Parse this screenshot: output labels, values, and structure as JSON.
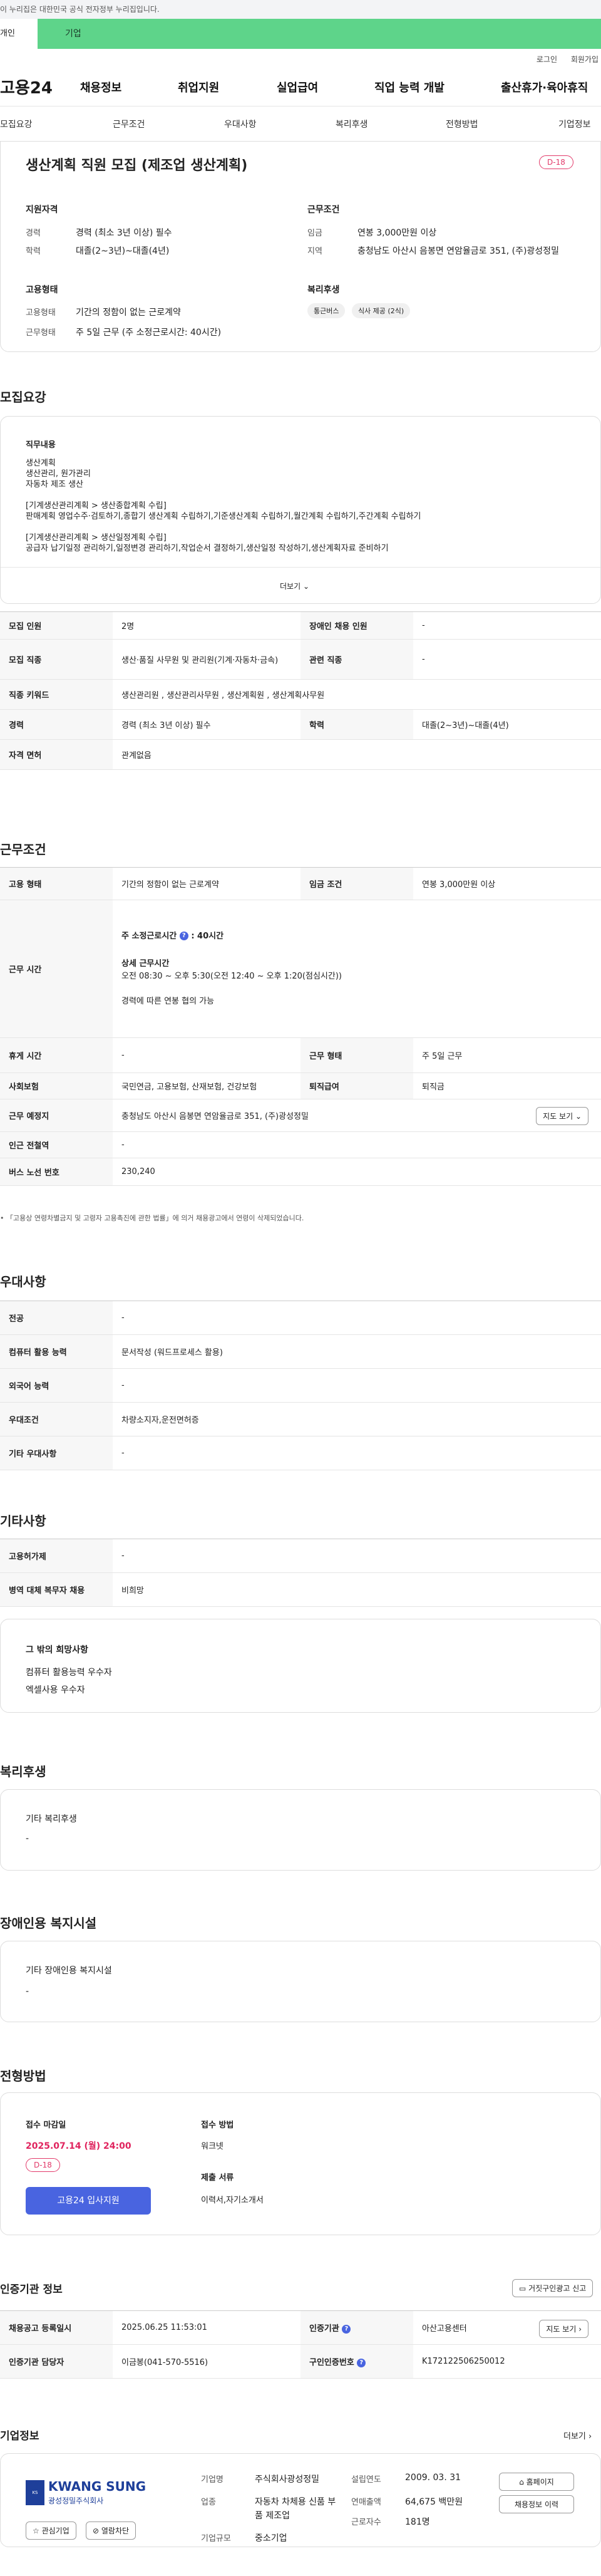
{
  "gov_banner": "이 누리집은 대한민국 공식 전자정부 누리집입니다.",
  "tabs": {
    "left": "개인",
    "right": "기업"
  },
  "util": {
    "login": "로그인",
    "join": "회원가입"
  },
  "gnb": {
    "logo": "고용24",
    "items": [
      "채용정보",
      "취업지원",
      "실업급여",
      "직업 능력 개발",
      "출산휴가·육아휴직"
    ]
  },
  "snb": [
    "모집요강",
    "근무조건",
    "우대사항",
    "복리후생",
    "전형방법",
    "기업정보"
  ],
  "summary": {
    "title": "생산계획 직원 모집 (제조업 생산계획)",
    "dday": "D-18",
    "qual_head": "지원자격",
    "career_label": "경력",
    "career": "경력 (최소 3년 이상) 필수",
    "edu_label": "학력",
    "edu": "대졸(2~3년)~대졸(4년)",
    "work_head": "근무조건",
    "wage_label": "임금",
    "wage": "연봉 3,000만원 이상",
    "region_label": "지역",
    "region": "충청남도 아산시 음봉면 연암율금로 351, (주)광성정밀",
    "emp_head": "고용형태",
    "type_label": "고용형태",
    "type": "기간의 정함이 없는 근로계약",
    "form_label": "근무형태",
    "form": "주 5일 근무 (주 소정근로시간: 40시간)",
    "welfare_head": "복리후생",
    "chips": [
      "통근버스",
      "식사 제공 (2식)"
    ]
  },
  "recruit": {
    "title": "모집요강",
    "job_head": "직무내용",
    "lines": [
      "생산계획",
      "생산관리, 원가관리",
      "자동차 제조 생산",
      "",
      "[기계생산관리계획 > 생산종합계획 수립]",
      "판매계획 영업수주·검토하기,종합기 생산계획 수립하기,기준생산계획 수립하기,월간계획 수립하기,주간계획 수립하기",
      "",
      "[기계생산관리계획 > 생산일정계획 수립]",
      "공급자 납기일정 관리하기,일정변경 관리하기,작업순서 결정하기,생산일정 작성하기,생산계획자료 준비하기"
    ],
    "more": "더보기",
    "rows": [
      {
        "l1": "모집 인원",
        "v1": "2명",
        "l2": "장애인 채용 인원",
        "v2": "-"
      },
      {
        "l1": "모집 직종",
        "v1": "생산·품질 사무원 및 관리원(기계·자동차·금속)",
        "l2": "관련 직종",
        "v2": "-"
      },
      {
        "l1": "직종 키워드",
        "v1": "생산관리원 , 생산관리사무원 , 생산계획원 , 생산계획사무원"
      },
      {
        "l1": "경력",
        "v1": "경력 (최소 3년 이상) 필수",
        "l2": "학력",
        "v2": "대졸(2~3년)~대졸(4년)"
      },
      {
        "l1": "자격 면허",
        "v1": "관계없음"
      }
    ]
  },
  "work": {
    "title": "근무조건",
    "type_l": "고용 형태",
    "type_v": "기간의 정함이 없는 근로계약",
    "wage_l": "임금 조건",
    "wage_v": "연봉 3,000만원 이상",
    "time_l": "근무 시간",
    "time_head": "주 소정근로시간",
    "time_hours": ": 40시간",
    "time_detail_head": "상세 근무시간",
    "time_detail": "오전 08:30 ~ 오후 5:30(오전 12:40 ~ 오후 1:20(점심시간))",
    "time_note": "경력에 따른 연봉 협의 가능",
    "rest_l": "휴게 시간",
    "rest_v": "-",
    "form_l": "근무 형태",
    "form_v": "주 5일 근무",
    "ins_l": "사회보험",
    "ins_v": "국민연금, 고용보험, 산재보험, 건강보험",
    "ret_l": "퇴직급여",
    "ret_v": "퇴직금",
    "place_l": "근무 예정지",
    "place_v": "충청남도 아산시 음봉면 연암율금로 351, (주)광성정밀",
    "map_btn": "지도 보기",
    "sub_l": "인근 전철역",
    "sub_v": "-",
    "bus_l": "버스 노선 번호",
    "bus_v": "230,240",
    "note": "「고용상 연령차별금지 및 고령자 고용촉진에 관한 법률」에 의거 채용광고에서 연령이 삭제되었습니다."
  },
  "pref": {
    "title": "우대사항",
    "rows": [
      {
        "l": "전공",
        "v": "-"
      },
      {
        "l": "컴퓨터 활용 능력",
        "v": "문서작성 (워드프로세스 활용)"
      },
      {
        "l": "외국어 능력",
        "v": "-"
      },
      {
        "l": "우대조건",
        "v": "차량소지자,운전면허증"
      },
      {
        "l": "기타 우대사항",
        "v": "-"
      }
    ]
  },
  "etc": {
    "title": "기타사항",
    "rows": [
      {
        "l": "고용허가제",
        "v": "-"
      },
      {
        "l": "병역 대체 복무자 채용",
        "v": "비희망"
      }
    ],
    "box_head": "그 밖의 희망사항",
    "box_lines": [
      "컴퓨터 활용능력 우수자",
      "엑셀사용 우수자"
    ]
  },
  "welfare": {
    "title": "복리후생",
    "head": "기타 복리후생",
    "value": "-"
  },
  "disabled": {
    "title": "장애인용 복지시설",
    "head": "기타 장애인용 복지시설",
    "value": "-"
  },
  "selection": {
    "title": "전형방법",
    "deadline_l": "접수 마감일",
    "deadline": "2025.07.14 (월) 24:00",
    "dday": "D-18",
    "apply_btn": "고용24 입사지원",
    "method_l": "접수 방법",
    "method_v": "워크넷",
    "docs_l": "제출 서류",
    "docs_v": "이력서,자기소개서"
  },
  "cert": {
    "title": "인증기관 정보",
    "report_btn": "거짓구인광고 신고",
    "reg_l": "채용공고 등록일시",
    "reg_v": "2025.06.25 11:53:01",
    "org_l": "인증기관",
    "org_v": "아산고용센터",
    "map_btn": "지도 보기",
    "mgr_l": "인증기관 담당자",
    "mgr_v": "이금봉(041-570-5516)",
    "no_l": "구인인증번호",
    "no_v": "K172122506250012"
  },
  "company": {
    "title": "기업정보",
    "more": "더보기",
    "logo_en": "KWANG SUNG",
    "logo_ko": "광성정밀주식회사",
    "fav_btn": "관심기업",
    "block_btn": "열람차단",
    "name_l": "기업명",
    "name_v": "주식회사광성정밀",
    "ind_l": "업종",
    "ind_v": "자동차 차체용 신품 부품 제조업",
    "size_l": "기업규모",
    "size_v": "중소기업",
    "est_l": "설립연도",
    "est_v": "2009. 03. 31",
    "sales_l": "연매출액",
    "sales_v": "64,675 백만원",
    "emp_l": "근로자수",
    "emp_v": "181명",
    "home_btn": "홈페이지",
    "hist_btn": "채용정보 이력"
  }
}
